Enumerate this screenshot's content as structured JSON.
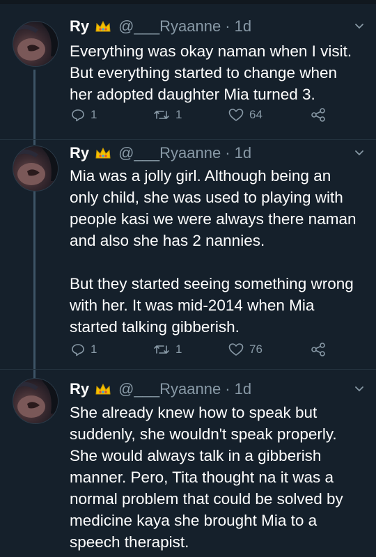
{
  "colors": {
    "background": "#15202b",
    "text": "#ffffff",
    "secondary": "#8899a6",
    "thread_line": "#3d5466"
  },
  "tweets": [
    {
      "name": "Ry",
      "handle": "@___Ryaanne",
      "time": "· 1d",
      "text": "Everything was okay naman when I visit.\nBut everything started to change when\nher adopted daughter Mia turned 3.",
      "replies": "1",
      "retweets": "1",
      "likes": "64"
    },
    {
      "name": "Ry",
      "handle": "@___Ryaanne",
      "time": "· 1d",
      "text": "Mia was a jolly girl. Although being an\nonly child, she was used to playing with\npeople kasi we were always there naman\nand also she has 2 nannies.\n\nBut they started seeing something wrong\nwith her. It was mid-2014 when Mia\nstarted talking gibberish.",
      "replies": "1",
      "retweets": "1",
      "likes": "76"
    },
    {
      "name": "Ry",
      "handle": "@___Ryaanne",
      "time": "· 1d",
      "text": "She already knew how to speak but\nsuddenly, she wouldn't speak properly.\nShe would always talk in a gibberish\nmanner. Pero, Tita thought na it was a\nnormal problem that could be solved by\nmedicine kaya she brought Mia to a\nspeech therapist."
    }
  ]
}
